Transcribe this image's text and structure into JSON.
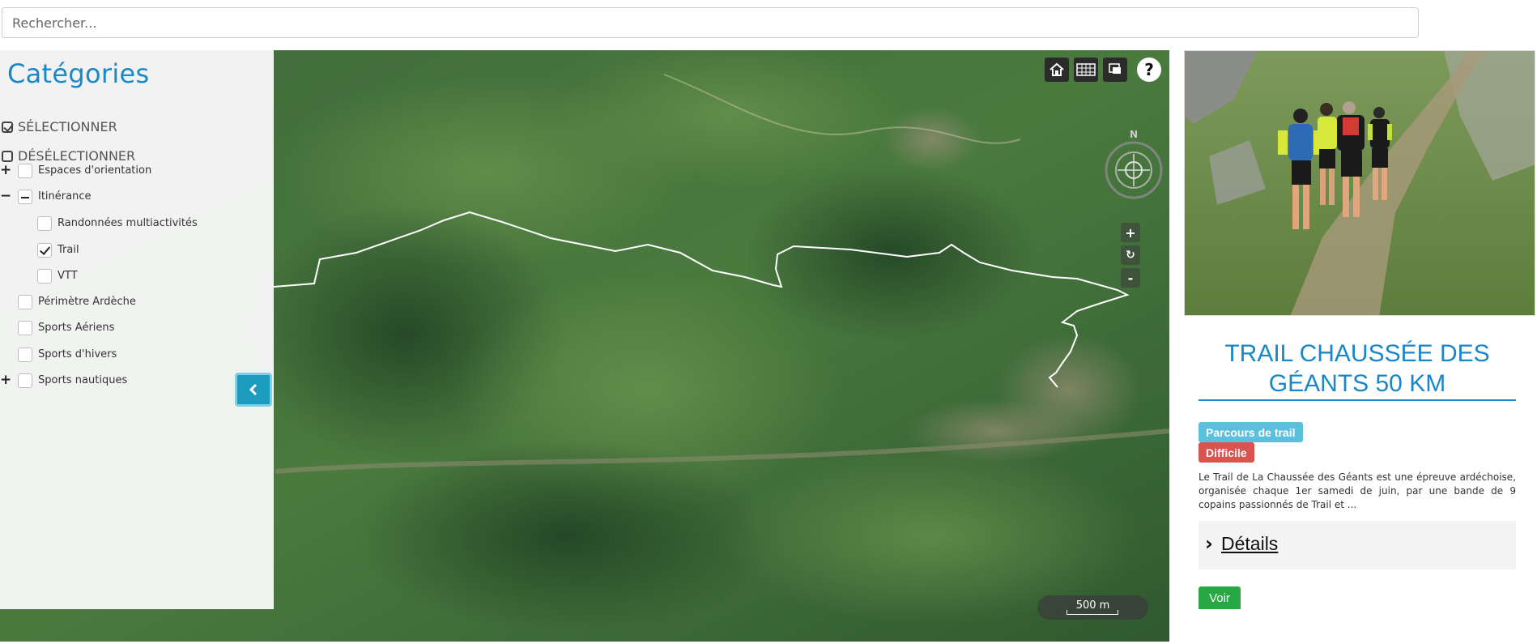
{
  "search": {
    "placeholder": "Rechercher..."
  },
  "sidebar": {
    "title": "Catégories",
    "select_all": "SÉLECTIONNER",
    "deselect_all": "DÉSÉLECTIONNER",
    "categories": [
      {
        "label": "Espaces d'orientation",
        "expander": "+",
        "state": "unchecked"
      },
      {
        "label": "Itinérance",
        "expander": "−",
        "state": "partial",
        "children": [
          {
            "label": "Randonnées multiactivités",
            "state": "unchecked"
          },
          {
            "label": "Trail",
            "state": "checked"
          },
          {
            "label": "VTT",
            "state": "unchecked"
          }
        ]
      },
      {
        "label": "Périmètre Ardèche",
        "state": "unchecked"
      },
      {
        "label": "Sports Aériens",
        "state": "unchecked"
      },
      {
        "label": "Sports d'hivers",
        "state": "unchecked"
      },
      {
        "label": "Sports nautiques",
        "expander": "+",
        "state": "unchecked"
      }
    ],
    "collapse_icon": "chevron-left-icon"
  },
  "map": {
    "tools": [
      "home-icon",
      "grid-icon",
      "layers-icon"
    ],
    "help_label": "?",
    "compass_label": "N",
    "zoom_in": "+",
    "reset": "↻",
    "zoom_out": "-",
    "scale_label": "500 m",
    "route_color": "#ffffff"
  },
  "detail": {
    "title": "TRAIL CHAUSSÉE DES GÉANTS 50 KM",
    "tags": [
      {
        "label": "Parcours de trail",
        "color": "#5bc0de"
      },
      {
        "label": "Difficile",
        "color": "#d9534f"
      }
    ],
    "description": "Le Trail de La Chaussée des Géants est une épreuve ardéchoise, organisée chaque 1er samedi de juin, par une bande de 9 copains passionnés de Trail et ...",
    "details_label": " Détails",
    "voir_label": "Voir"
  },
  "colors": {
    "accent": "#1a87c8",
    "collapse_btn": "#1b9cbf",
    "voir": "#28a745"
  }
}
